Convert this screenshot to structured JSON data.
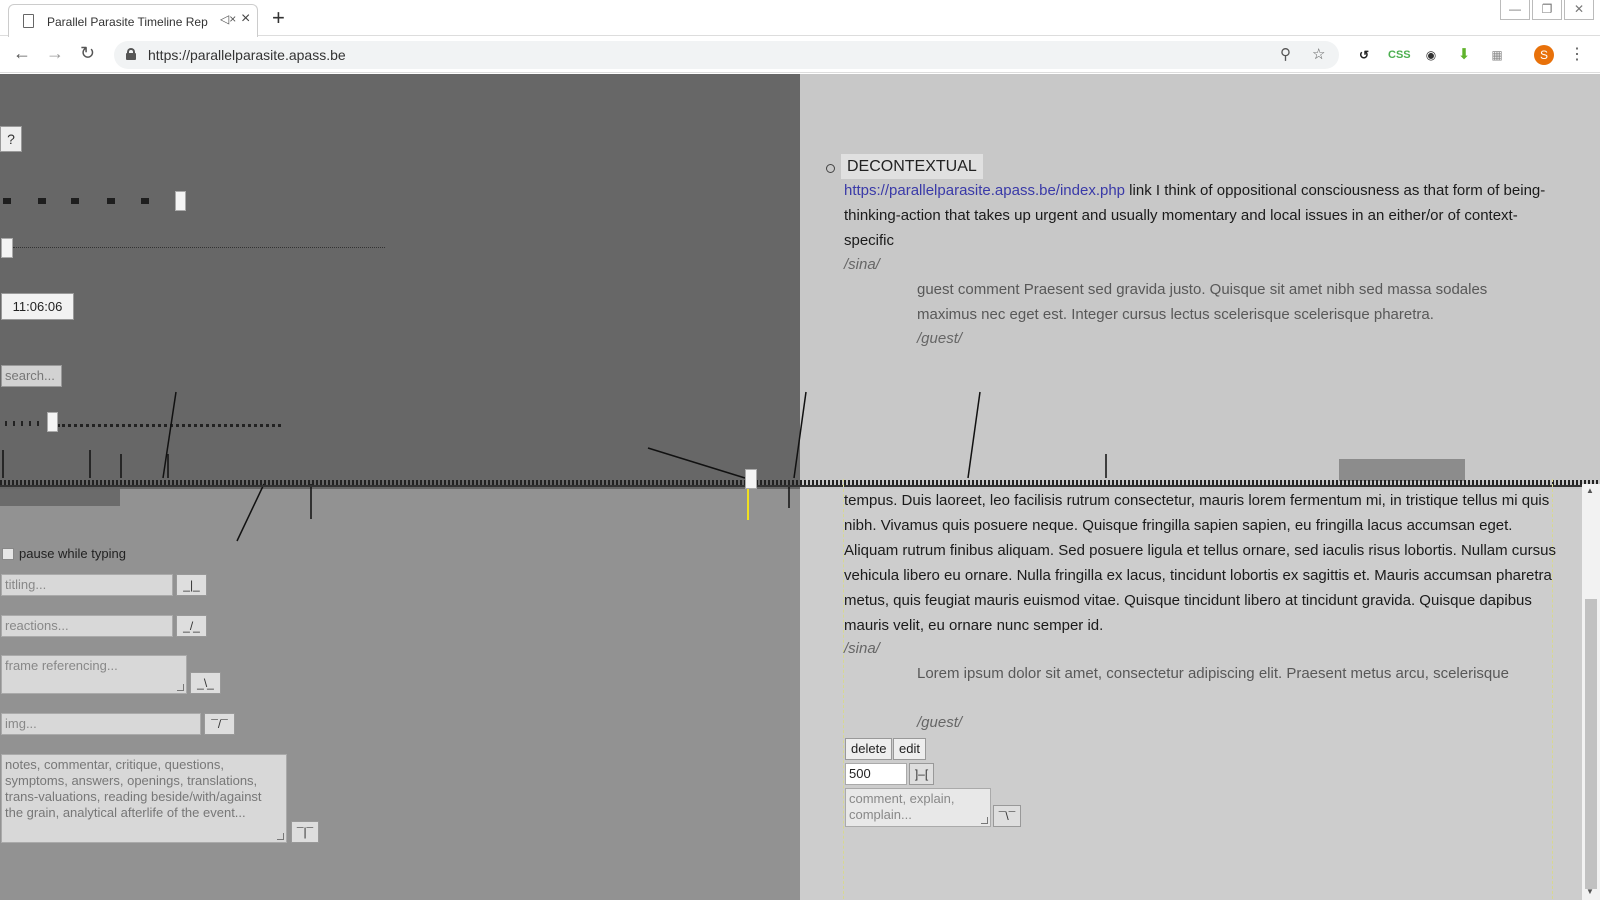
{
  "browser": {
    "tab_title": "Parallel Parasite Timeline Rep",
    "url": "https://parallelparasite.apass.be",
    "avatar_letter": "S",
    "css_ext_label": "CSS"
  },
  "left_panel": {
    "help_label": "?",
    "clock": "11:06:06",
    "search_placeholder": "search...",
    "pause_label": "pause while typing",
    "titling_placeholder": "titling...",
    "titling_glyph": "_|_",
    "reactions_placeholder": "reactions...",
    "reactions_glyph": "_/_",
    "frame_placeholder": "frame referencing...",
    "frame_glyph": "_\\_",
    "img_placeholder": "img...",
    "img_glyph": "¯/¯",
    "notes_placeholder": "notes, commentar, critique, questions, symptoms, answers, openings, translations, trans-valuations, reading beside/with/against the grain, analytical afterlife of the event...",
    "notes_glyph": "¯|¯"
  },
  "right_panel": {
    "post_title": "DECONTEXTUAL",
    "post_link": "https://parallelparasite.apass.be/index.php",
    "post_text": " link I think of oppositional consciousness as that form of being-thinking-action that takes up urgent and usually momentary and local issues in an either/or of context-specific",
    "post_author": "/sina/",
    "guest_comment": "guest comment Praesent sed gravida justo. Quisque sit amet nibh sed massa sodales maximus nec eget est. Integer cursus lectus scelerisque scelerisque pharetra.",
    "guest_author": "/guest/",
    "body_text": "tempus. Duis laoreet, leo facilisis rutrum consectetur, mauris lorem fermentum mi, in tristique tellus mi quis nibh. Vivamus quis posuere neque. Quisque fringilla sapien sapien, eu fringilla lacus accumsan eget. Aliquam rutrum finibus aliquam. Sed posuere ligula et tellus ornare, sed iaculis risus lobortis. Nullam cursus vehicula libero eu ornare. Nulla fringilla ex lacus, tincidunt lobortis ex sagittis et. Mauris accumsan pharetra metus, quis feugiat mauris euismod vitae. Quisque tincidunt libero at tincidunt gravida. Quisque dapibus mauris velit, eu ornare nunc semper id.",
    "body_author": "/sina/",
    "guest_comment_2": "Lorem ipsum dolor sit amet, consectetur adipiscing elit. Praesent metus arcu, scelerisque",
    "guest_author_2": "/guest/",
    "delete_label": "delete",
    "edit_label": "edit",
    "duration_value": "500",
    "duration_glyph": "]–[",
    "comment_placeholder": "comment, explain, complain...",
    "comment_glyph": "¯\\¯"
  }
}
